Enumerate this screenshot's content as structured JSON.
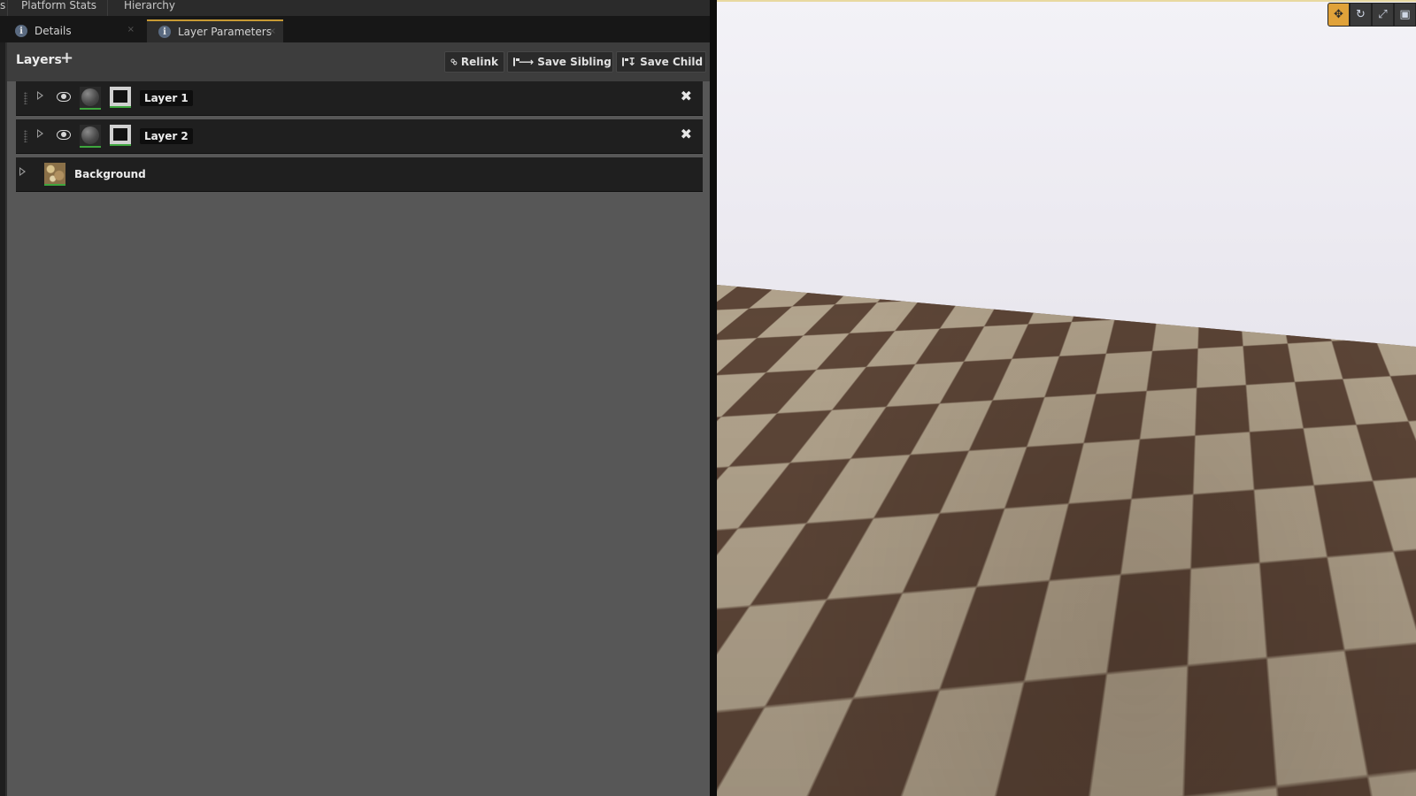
{
  "top_tabs": {
    "partial": "s",
    "platform_stats": "Platform Stats",
    "hierarchy": "Hierarchy"
  },
  "panel_tabs": {
    "details": "Details",
    "layer_parameters": "Layer Parameters"
  },
  "layers_panel": {
    "title": "Layers",
    "add_symbol": "+",
    "relink_label": "Relink",
    "save_sibling_label": "Save Sibling",
    "save_child_label": "Save Child",
    "remove_symbol": "✖",
    "layers": [
      {
        "name": "Layer 1"
      },
      {
        "name": "Layer 2"
      }
    ],
    "background": {
      "name": "Background"
    }
  },
  "icons": {
    "info": "info-icon",
    "link": "link-icon",
    "save": "floppy-disk-icon",
    "visibility": "eye-icon",
    "translate": "move-arrows-icon",
    "rotate": "rotate-icon",
    "scale": "scale-icon",
    "surface": "cube-icon"
  },
  "colors": {
    "active_tab_accent": "#c79a34",
    "thumbnail_underline": "#3ea63e",
    "active_tool": "#e0a23a"
  }
}
